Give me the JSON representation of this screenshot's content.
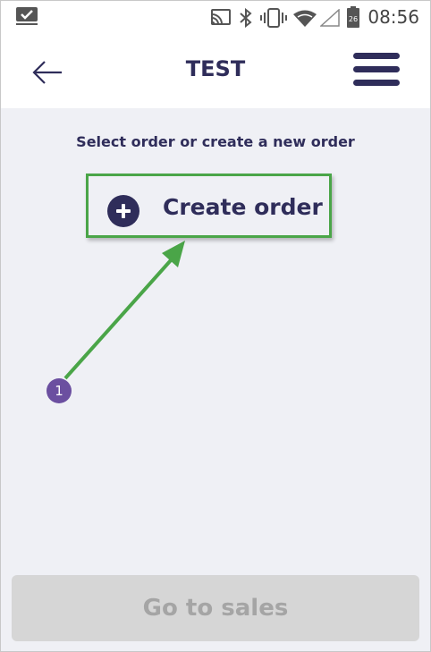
{
  "status_bar": {
    "time": "08:56",
    "battery_level": "26",
    "icons": [
      "notification-check-icon",
      "cast-icon",
      "bluetooth-icon",
      "vibrate-icon",
      "wifi-icon",
      "signal-icon",
      "battery-icon"
    ]
  },
  "header": {
    "title": "TEST",
    "back_icon": "back-arrow-icon",
    "menu_icon": "hamburger-menu-icon"
  },
  "main": {
    "instruction": "Select order or create a new order",
    "create_order_label": "Create order",
    "create_order_icon": "plus-circle-icon"
  },
  "annotation": {
    "step_number": "1",
    "highlight_color": "#4aa548",
    "badge_color": "#6b4fa0"
  },
  "footer": {
    "go_to_sales_label": "Go to sales"
  },
  "colors": {
    "primary": "#2f2d5a",
    "background": "#eff0f5",
    "disabled_button": "#d6d6d6"
  }
}
